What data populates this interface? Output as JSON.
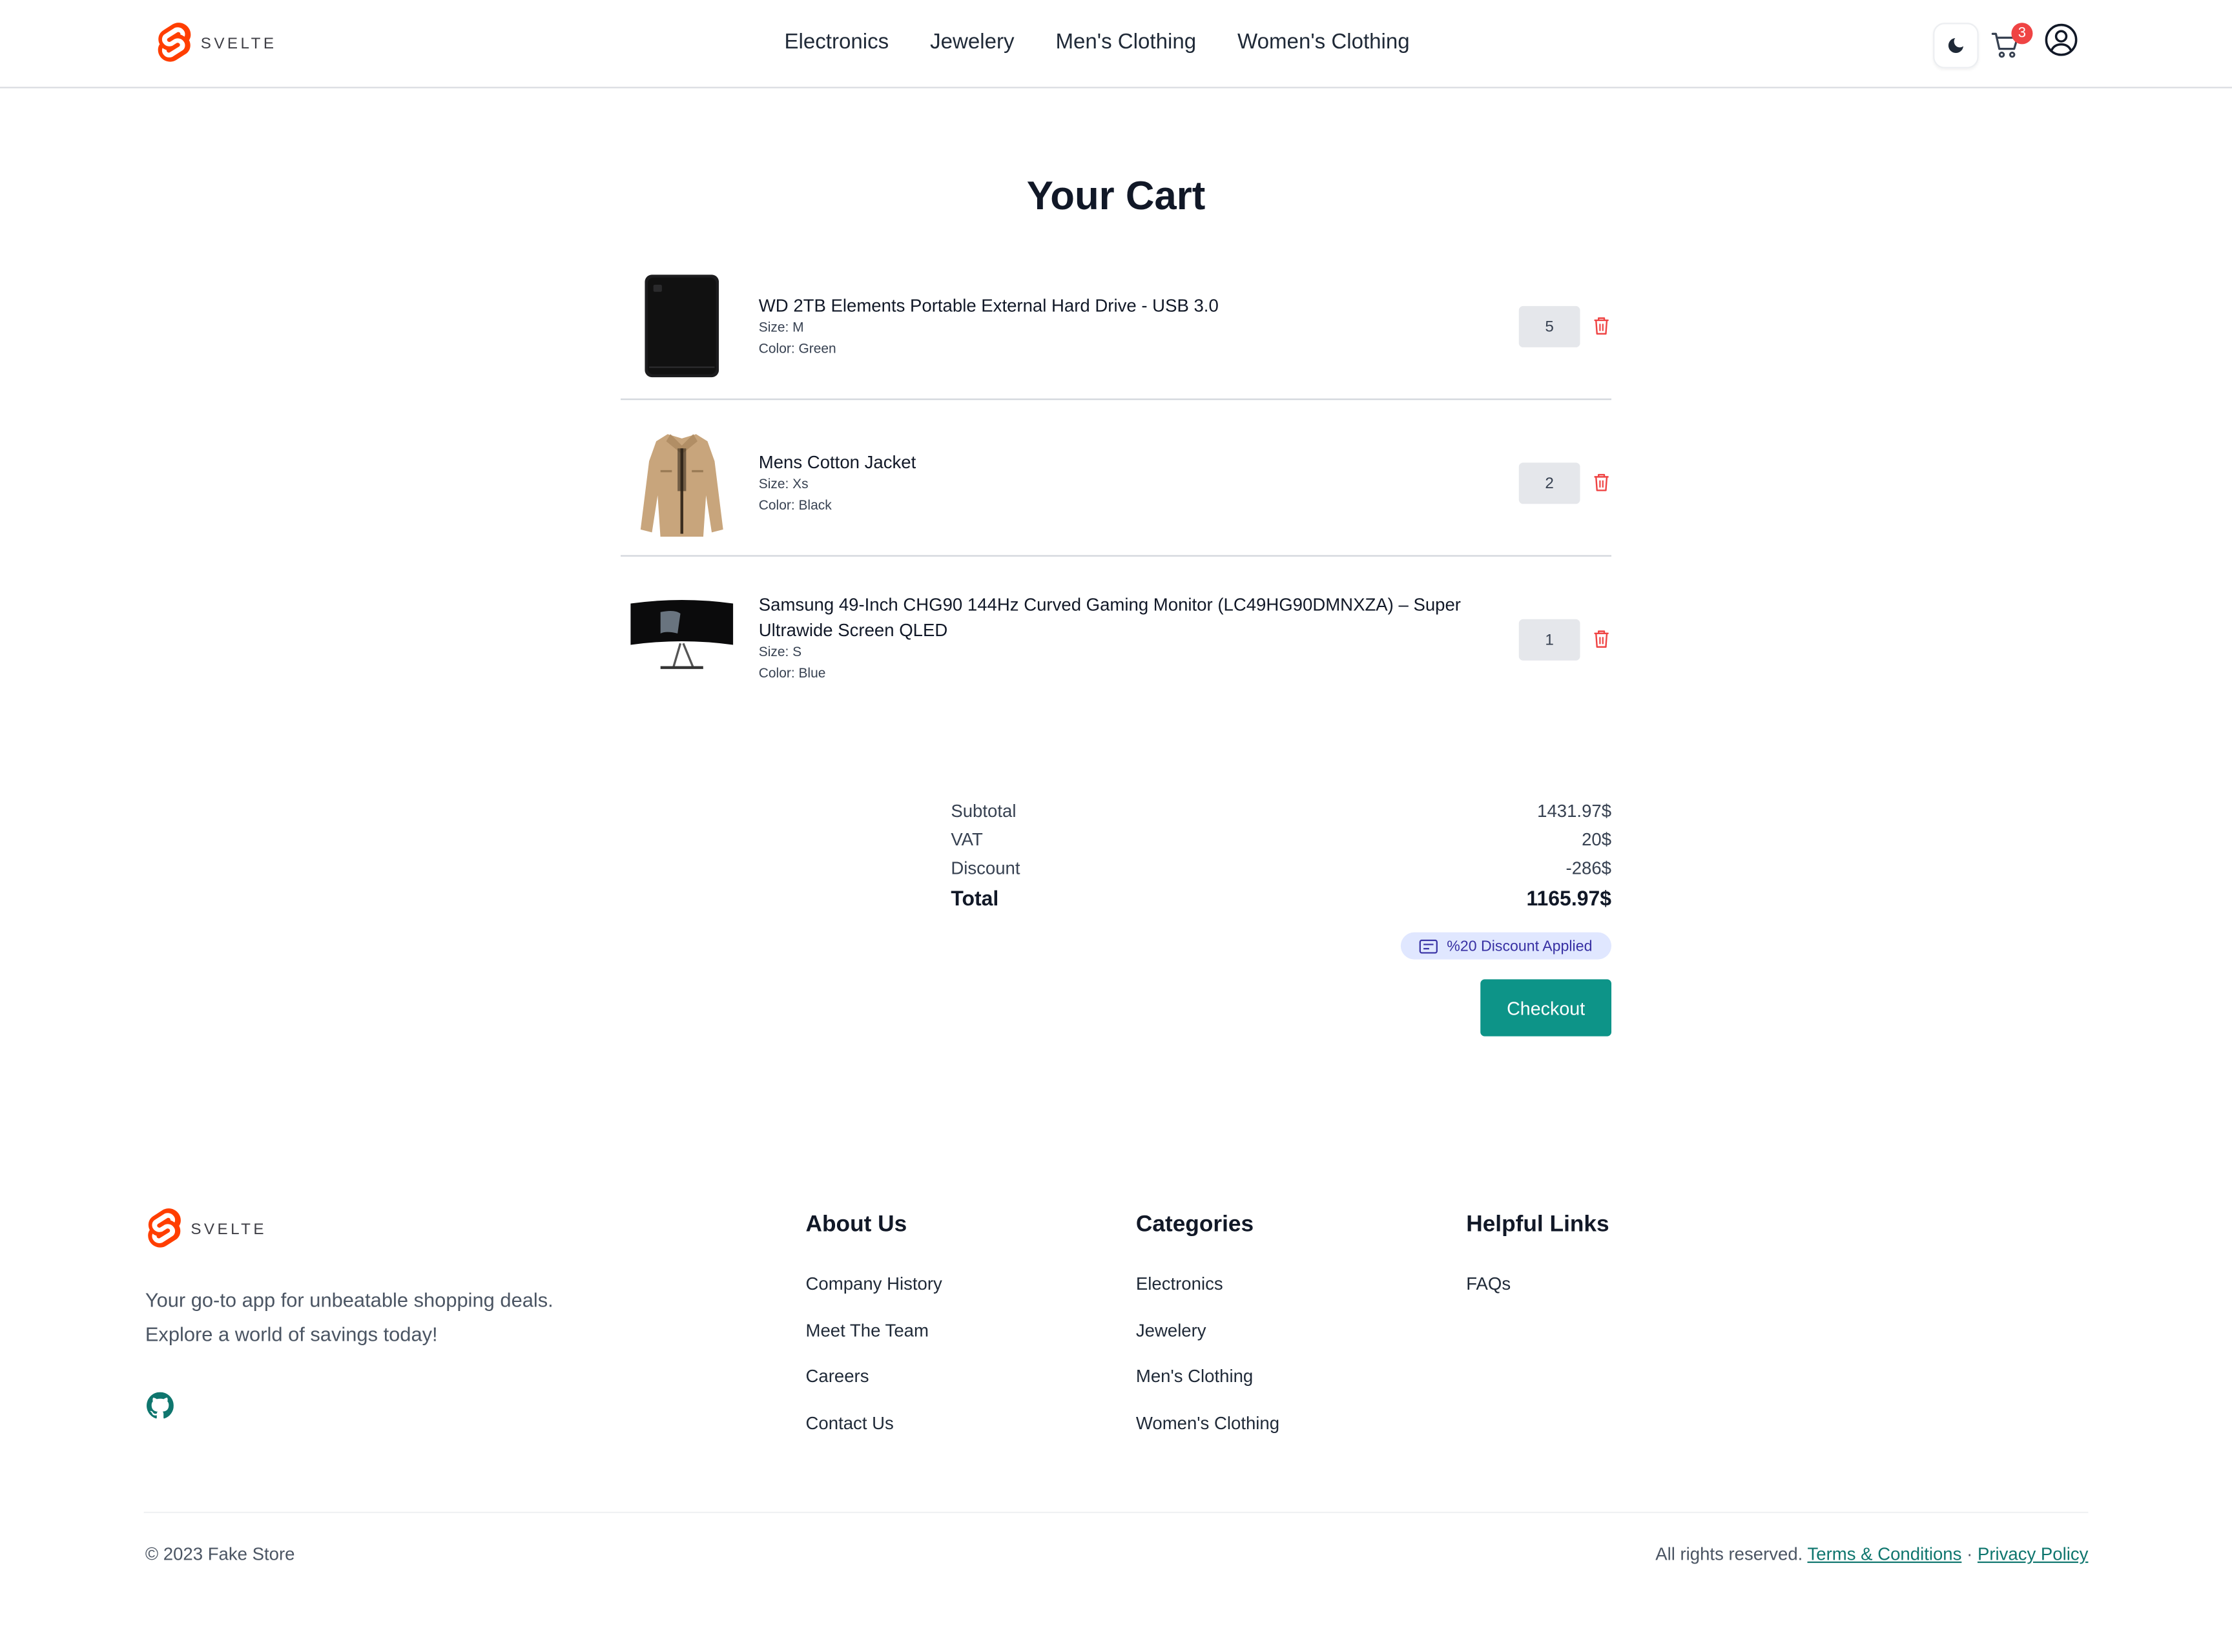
{
  "brand": {
    "logo_text": "SVELTE"
  },
  "nav": {
    "items": [
      "Electronics",
      "Jewelery",
      "Men's Clothing",
      "Women's Clothing"
    ]
  },
  "header": {
    "cart_count": "3"
  },
  "cart": {
    "title": "Your Cart",
    "items": [
      {
        "name": "WD 2TB Elements Portable External Hard Drive - USB 3.0",
        "size": "Size: M",
        "color": "Color: Green",
        "qty": "5",
        "thumb_icon": "hard-drive-image"
      },
      {
        "name": "Mens Cotton Jacket",
        "size": "Size: Xs",
        "color": "Color: Black",
        "qty": "2",
        "thumb_icon": "jacket-image"
      },
      {
        "name": "Samsung 49-Inch CHG90 144Hz Curved Gaming Monitor (LC49HG90DMNXZA) – Super Ultrawide Screen QLED",
        "size": "Size: S",
        "color": "Color: Blue",
        "qty": "1",
        "thumb_icon": "monitor-image"
      }
    ]
  },
  "summary": {
    "subtotal_label": "Subtotal",
    "subtotal": "1431.97$",
    "vat_label": "VAT",
    "vat": "20$",
    "discount_label": "Discount",
    "discount": "-286$",
    "total_label": "Total",
    "total": "1165.97$",
    "discount_badge": "%20 Discount Applied",
    "checkout_label": "Checkout"
  },
  "footer": {
    "tagline": "Your go-to app for unbeatable shopping deals. Explore a world of savings today!",
    "columns": [
      {
        "title": "About Us",
        "links": [
          "Company History",
          "Meet The Team",
          "Careers",
          "Contact Us"
        ]
      },
      {
        "title": "Categories",
        "links": [
          "Electronics",
          "Jewelery",
          "Men's Clothing",
          "Women's Clothing"
        ]
      },
      {
        "title": "Helpful Links",
        "links": [
          "FAQs"
        ]
      }
    ],
    "copyright": "© 2023 Fake Store",
    "rights": "All rights reserved.",
    "terms": "Terms & Conditions",
    "separator": "·",
    "privacy": "Privacy Policy"
  },
  "colors": {
    "accent": "#0d9488",
    "brand": "#ff3e00",
    "badge": "#ef4444",
    "danger": "#ef4444"
  }
}
